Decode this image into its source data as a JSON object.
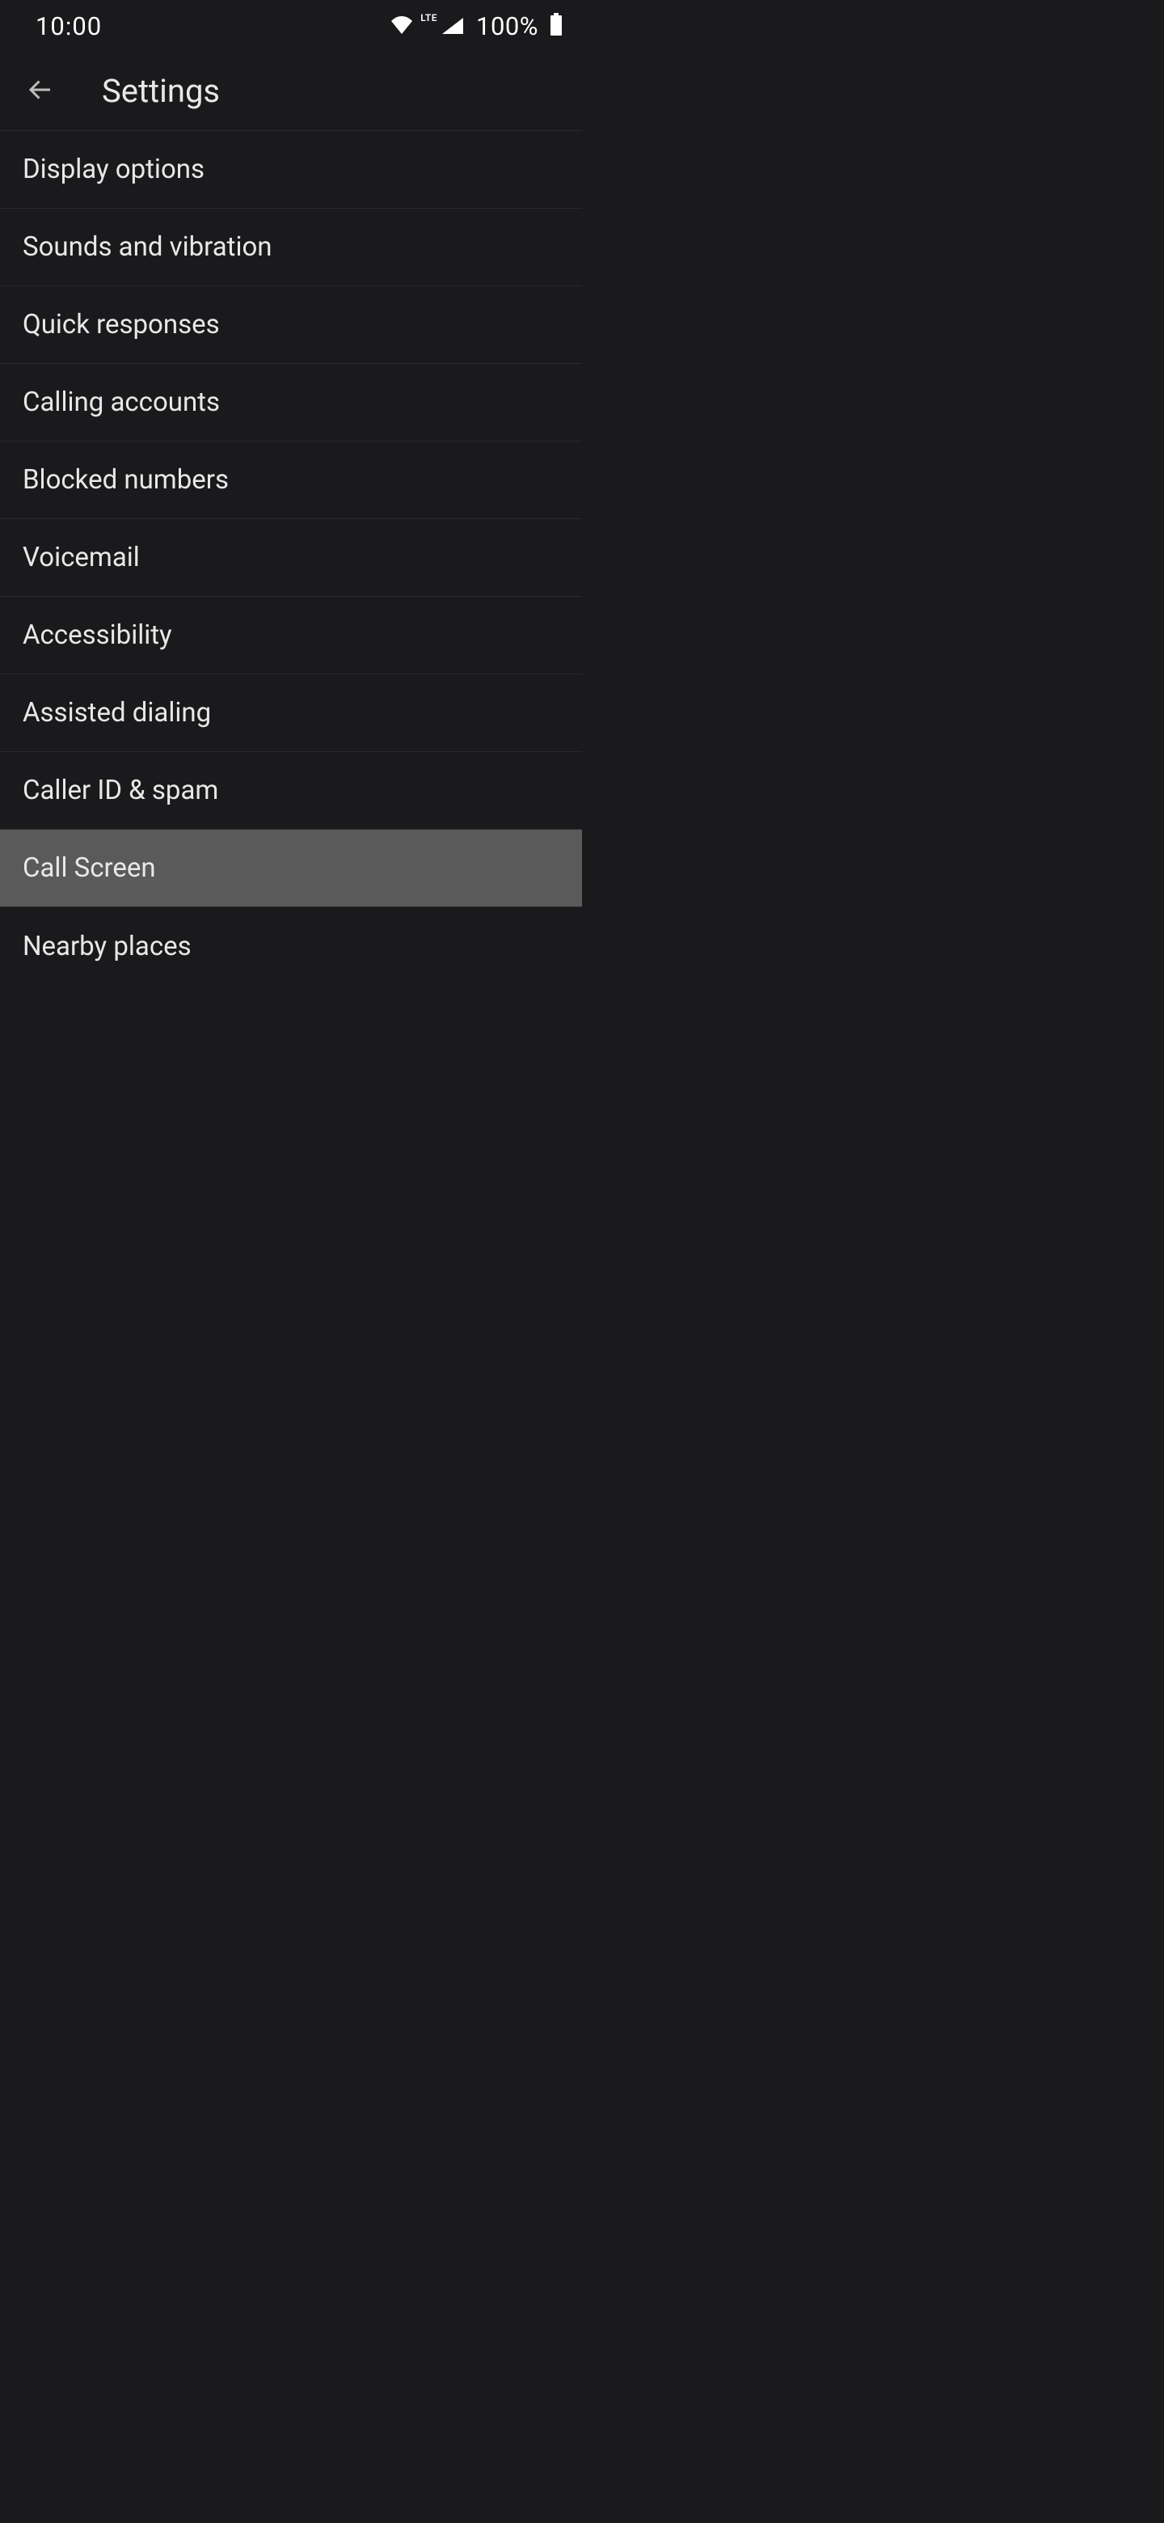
{
  "status_bar": {
    "time": "10:00",
    "lte": "LTE",
    "battery_percent": "100%"
  },
  "app_bar": {
    "title": "Settings"
  },
  "settings": {
    "items": [
      {
        "label": "Display options",
        "highlighted": false
      },
      {
        "label": "Sounds and vibration",
        "highlighted": false
      },
      {
        "label": "Quick responses",
        "highlighted": false
      },
      {
        "label": "Calling accounts",
        "highlighted": false
      },
      {
        "label": "Blocked numbers",
        "highlighted": false
      },
      {
        "label": "Voicemail",
        "highlighted": false
      },
      {
        "label": "Accessibility",
        "highlighted": false
      },
      {
        "label": "Assisted dialing",
        "highlighted": false
      },
      {
        "label": "Caller ID & spam",
        "highlighted": false
      },
      {
        "label": "Call Screen",
        "highlighted": true
      },
      {
        "label": "Nearby places",
        "highlighted": false
      }
    ]
  }
}
